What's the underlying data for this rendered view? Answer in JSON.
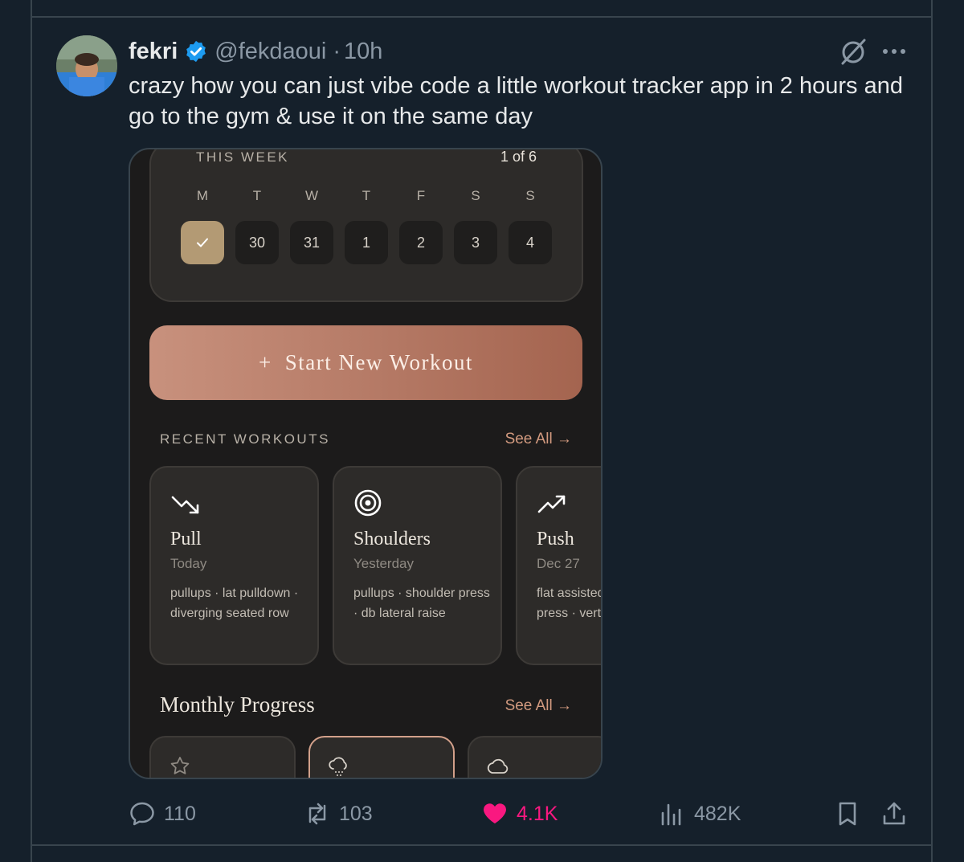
{
  "tweet": {
    "author_name": "fekri",
    "handle": "@fekdaoui",
    "separator": "·",
    "time": "10h",
    "text": "crazy how you can just vibe code a little workout tracker app in 2 hours and go to the gym & use it on the same day"
  },
  "app": {
    "week": {
      "label": "THIS WEEK",
      "count": "1 of 6",
      "days": [
        {
          "letter": "M",
          "date": "",
          "done": true
        },
        {
          "letter": "T",
          "date": "30"
        },
        {
          "letter": "W",
          "date": "31"
        },
        {
          "letter": "T",
          "date": "1"
        },
        {
          "letter": "F",
          "date": "2"
        },
        {
          "letter": "S",
          "date": "3"
        },
        {
          "letter": "S",
          "date": "4"
        }
      ]
    },
    "start_button": {
      "plus": "+",
      "label": "Start New Workout"
    },
    "recent": {
      "label": "RECENT WORKOUTS",
      "see_all": "See All →",
      "cards": [
        {
          "icon": "trending-down-icon",
          "title": "Pull",
          "date": "Today",
          "desc": "pullups · lat pulldown · diverging seated row"
        },
        {
          "icon": "target-icon",
          "title": "Shoulders",
          "date": "Yesterday",
          "desc": "pullups · shoulder press · db lateral raise"
        },
        {
          "icon": "trending-up-icon",
          "title": "Push",
          "date": "Dec 27",
          "desc_line1": "flat assisted",
          "desc_line2": "press · verti"
        }
      ]
    },
    "monthly": {
      "title": "Monthly Progress",
      "see_all": "See All →",
      "cards": [
        {
          "icon": "star-icon"
        },
        {
          "icon": "cloud-snow-icon"
        },
        {
          "icon": "cloud-icon"
        }
      ]
    }
  },
  "actions": {
    "replies": "110",
    "reposts": "103",
    "likes": "4.1K",
    "views": "482K"
  },
  "colors": {
    "background": "#15202b",
    "like_pink": "#f91880",
    "verified_blue": "#1d9bf0",
    "accent_copper": "#d29a7f",
    "button_gradient_start": "#c8917d",
    "button_gradient_end": "#a4644f"
  }
}
